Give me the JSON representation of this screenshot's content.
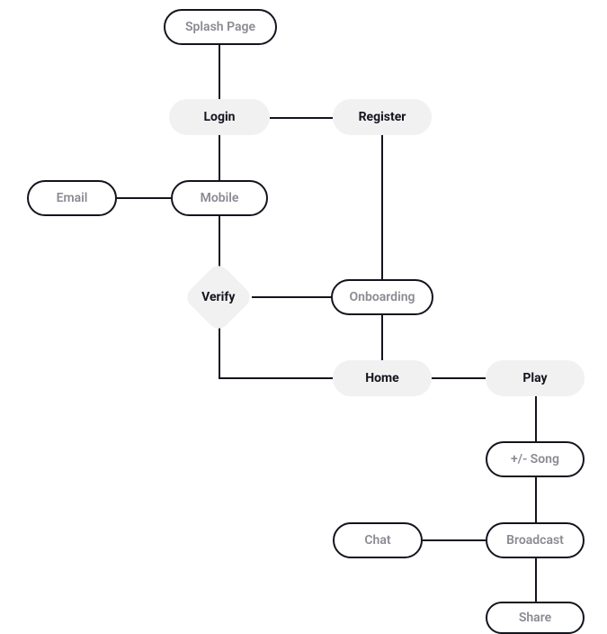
{
  "nodes": {
    "splash": "Splash Page",
    "login": "Login",
    "register": "Register",
    "email": "Email",
    "mobile": "Mobile",
    "verify": "Verify",
    "onboarding": "Onboarding",
    "home": "Home",
    "play": "Play",
    "song": "+/- Song",
    "chat": "Chat",
    "broadcast": "Broadcast",
    "share": "Share"
  },
  "flow": {
    "type": "flowchart",
    "edges": [
      [
        "splash",
        "login"
      ],
      [
        "login",
        "register"
      ],
      [
        "login",
        "mobile"
      ],
      [
        "mobile",
        "email"
      ],
      [
        "mobile",
        "verify"
      ],
      [
        "register",
        "onboarding"
      ],
      [
        "verify",
        "onboarding"
      ],
      [
        "verify",
        "home"
      ],
      [
        "onboarding",
        "home"
      ],
      [
        "home",
        "play"
      ],
      [
        "play",
        "song"
      ],
      [
        "song",
        "broadcast"
      ],
      [
        "broadcast",
        "chat"
      ],
      [
        "broadcast",
        "share"
      ]
    ]
  }
}
